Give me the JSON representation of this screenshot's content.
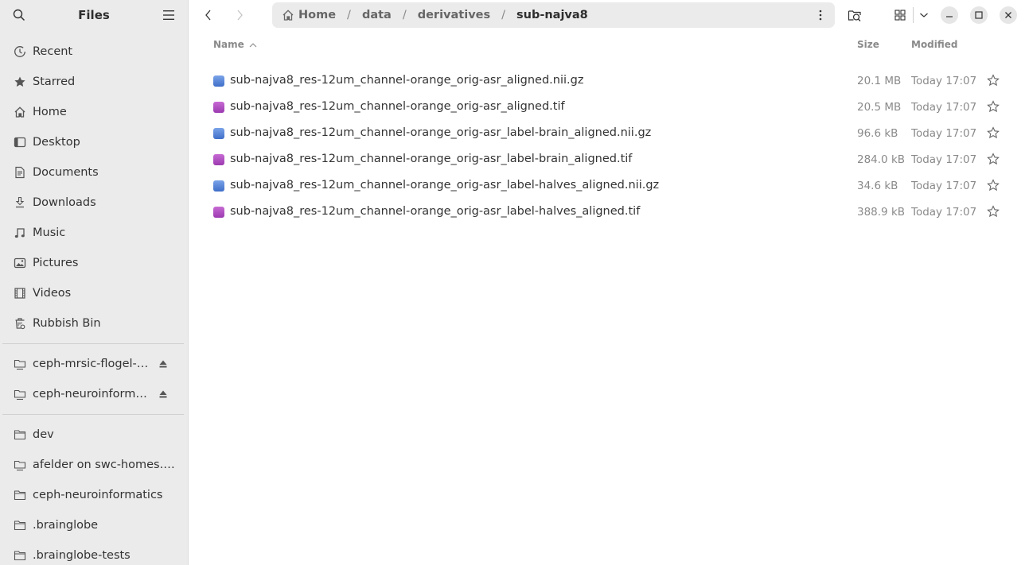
{
  "app": {
    "title": "Files"
  },
  "sidebar": {
    "places": [
      {
        "label": "Recent",
        "icon": "recent-icon"
      },
      {
        "label": "Starred",
        "icon": "star-icon"
      },
      {
        "label": "Home",
        "icon": "home-icon"
      },
      {
        "label": "Desktop",
        "icon": "desktop-icon"
      },
      {
        "label": "Documents",
        "icon": "documents-icon"
      },
      {
        "label": "Downloads",
        "icon": "downloads-icon"
      },
      {
        "label": "Music",
        "icon": "music-icon"
      },
      {
        "label": "Pictures",
        "icon": "pictures-icon"
      },
      {
        "label": "Videos",
        "icon": "videos-icon"
      },
      {
        "label": "Rubbish Bin",
        "icon": "trash-icon"
      }
    ],
    "mounts": [
      {
        "label": "ceph-mrsic-flogel-b…",
        "icon": "network-folder-icon",
        "ejectable": true
      },
      {
        "label": "ceph-neuroinforma…",
        "icon": "network-folder-icon",
        "ejectable": true
      }
    ],
    "bookmarks": [
      {
        "label": "dev",
        "icon": "folder-icon"
      },
      {
        "label": "afelder on swc-homes.a…",
        "icon": "network-folder-icon"
      },
      {
        "label": "ceph-neuroinformatics",
        "icon": "folder-icon"
      },
      {
        "label": ".brainglobe",
        "icon": "folder-icon"
      },
      {
        "label": ".brainglobe-tests",
        "icon": "folder-icon"
      }
    ]
  },
  "pathbar": {
    "crumbs": [
      "Home",
      "data",
      "derivatives",
      "sub-najva8"
    ],
    "separator": "/"
  },
  "columns": {
    "name": "Name",
    "size": "Size",
    "modified": "Modified",
    "sort": "name-ascending"
  },
  "files": [
    {
      "name": "sub-najva8_res-12um_channel-orange_orig-asr_aligned.nii.gz",
      "type": "nii",
      "size": "20.1 MB",
      "modified": "Today 17:07",
      "starred": false
    },
    {
      "name": "sub-najva8_res-12um_channel-orange_orig-asr_aligned.tif",
      "type": "tif",
      "size": "20.5 MB",
      "modified": "Today 17:07",
      "starred": false
    },
    {
      "name": "sub-najva8_res-12um_channel-orange_orig-asr_label-brain_aligned.nii.gz",
      "type": "nii",
      "size": "96.6 kB",
      "modified": "Today 17:07",
      "starred": false
    },
    {
      "name": "sub-najva8_res-12um_channel-orange_orig-asr_label-brain_aligned.tif",
      "type": "tif",
      "size": "284.0 kB",
      "modified": "Today 17:07",
      "starred": false
    },
    {
      "name": "sub-najva8_res-12um_channel-orange_orig-asr_label-halves_aligned.nii.gz",
      "type": "nii",
      "size": "34.6 kB",
      "modified": "Today 17:07",
      "starred": false
    },
    {
      "name": "sub-najva8_res-12um_channel-orange_orig-asr_label-halves_aligned.tif",
      "type": "tif",
      "size": "388.9 kB",
      "modified": "Today 17:07",
      "starred": false
    }
  ],
  "colors": {
    "sidebar_bg": "#ebebeb",
    "nii_icon": "#4f7fd6",
    "tif_icon": "#b24fc4"
  }
}
